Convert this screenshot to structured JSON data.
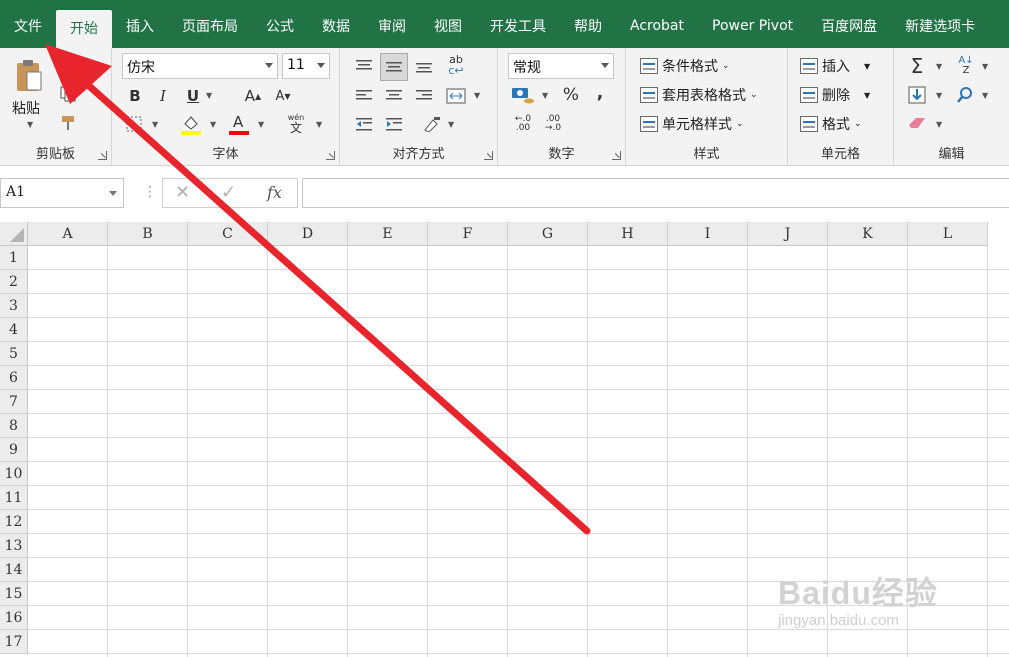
{
  "tabs": [
    {
      "label": "文件",
      "active": false
    },
    {
      "label": "开始",
      "active": true
    },
    {
      "label": "插入",
      "active": false
    },
    {
      "label": "页面布局",
      "active": false
    },
    {
      "label": "公式",
      "active": false
    },
    {
      "label": "数据",
      "active": false
    },
    {
      "label": "审阅",
      "active": false
    },
    {
      "label": "视图",
      "active": false
    },
    {
      "label": "开发工具",
      "active": false
    },
    {
      "label": "帮助",
      "active": false
    },
    {
      "label": "Acrobat",
      "active": false
    },
    {
      "label": "Power Pivot",
      "active": false
    },
    {
      "label": "百度网盘",
      "active": false
    },
    {
      "label": "新建选项卡",
      "active": false
    }
  ],
  "clipboard": {
    "paste_label": "粘贴",
    "group_label": "剪贴板"
  },
  "font": {
    "name": "仿宋",
    "size": "11",
    "group_label": "字体",
    "phonetic_top": "wén",
    "phonetic_bottom": "文",
    "fill_color": "#ffff00",
    "font_color": "#ff0000"
  },
  "alignment": {
    "group_label": "对齐方式"
  },
  "number": {
    "format": "常规",
    "group_label": "数字"
  },
  "styles": {
    "conditional": "条件格式",
    "table": "套用表格格式",
    "cell": "单元格样式",
    "group_label": "样式"
  },
  "cells_group": {
    "insert": "插入",
    "delete": "删除",
    "format": "格式",
    "group_label": "单元格"
  },
  "editing": {
    "group_label": "编辑"
  },
  "formula_bar": {
    "namebox": "A1",
    "fx": "fx"
  },
  "columns": [
    "A",
    "B",
    "C",
    "D",
    "E",
    "F",
    "G",
    "H",
    "I",
    "J",
    "K",
    "L"
  ],
  "rows": [
    "1",
    "2",
    "3",
    "4",
    "5",
    "6",
    "7",
    "8",
    "9",
    "10",
    "11",
    "12",
    "13",
    "14",
    "15",
    "16",
    "17"
  ],
  "watermark": {
    "main": "Baidu经验",
    "sub": "jingyan.baidu.com"
  },
  "colors": {
    "ribbon_green": "#217346",
    "arrow_red": "#e8242c"
  }
}
